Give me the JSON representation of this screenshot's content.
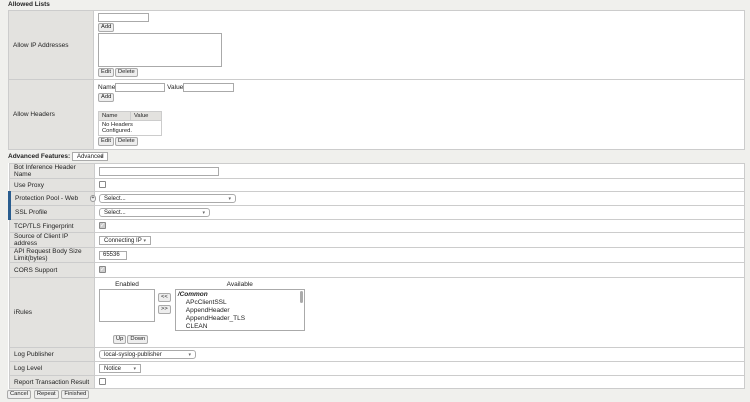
{
  "allowed_lists": {
    "title": "Allowed Lists",
    "ip": {
      "label": "Allow IP Addresses",
      "add": "Add",
      "edit": "Edit",
      "delete": "Delete"
    },
    "headers": {
      "label": "Allow Headers",
      "name_label": "Name",
      "value_label": "Value",
      "add": "Add",
      "col_name": "Name",
      "col_value": "Value",
      "empty": "No Headers Configured.",
      "edit": "Edit",
      "delete": "Delete"
    }
  },
  "advanced": {
    "label": "Advanced Features:",
    "mode": "Advanced",
    "rows": {
      "bot": "Bot Inference Header Name",
      "proxy": "Use Proxy",
      "pool": "Protection Pool - Web",
      "pool_value": "Select...",
      "ssl": "SSL Profile",
      "ssl_value": "Select...",
      "tcp": "TCP/TLS Fingerprint",
      "source": "Source of Client IP address",
      "source_value": "Connecting IP",
      "api": "API Request Body Size Limit(bytes)",
      "api_value": "65536",
      "cors": "CORS Support",
      "irules": "iRules",
      "enabled": "Enabled",
      "available": "Available",
      "move_left": "<<",
      "move_right": ">>",
      "up": "Up",
      "down": "Down",
      "available_items": [
        "/Common",
        "APcClientSSL",
        "AppendHeader",
        "AppendHeader_TLS",
        "CLEAN"
      ],
      "log_publisher": "Log Publisher",
      "log_publisher_value": "local-syslog-publisher",
      "log_level": "Log Level",
      "log_level_value": "Notice",
      "report": "Report Transaction Result"
    }
  },
  "actions": {
    "cancel": "Cancel",
    "repeat": "Repeat",
    "finished": "Finished"
  }
}
